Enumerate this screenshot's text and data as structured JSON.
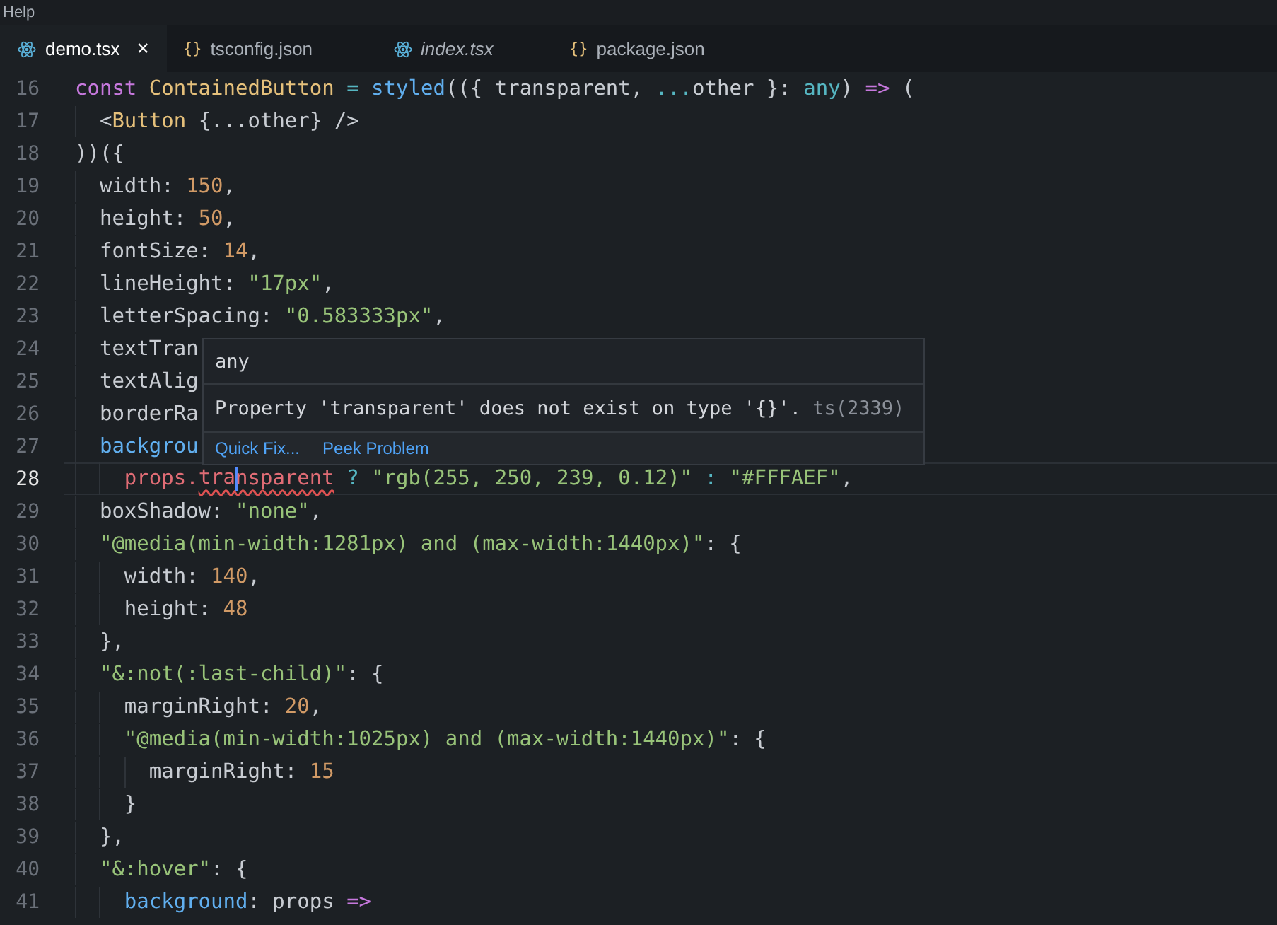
{
  "menu_bar": {
    "label": "Help"
  },
  "tabs": [
    {
      "label": "demo.tsx",
      "kind": "react",
      "selected": true,
      "preview": false,
      "close_glyph": "×"
    },
    {
      "label": "tsconfig.json",
      "kind": "json",
      "glyph": "{}",
      "selected": false,
      "preview": false
    },
    {
      "label": "index.tsx",
      "kind": "react",
      "selected": false,
      "preview": true
    },
    {
      "label": "package.json",
      "kind": "json",
      "glyph": "{}",
      "selected": false,
      "preview": false
    }
  ],
  "editor": {
    "lines": [
      {
        "number": "16",
        "current": false,
        "tokens": [
          {
            "kind": "kw",
            "text": "const "
          },
          {
            "kind": "type",
            "text": "ContainedButton"
          },
          {
            "kind": "op",
            "text": " = "
          },
          {
            "kind": "fn",
            "text": "styled"
          },
          {
            "kind": "plain",
            "text": "(({ transparent, "
          },
          {
            "kind": "op",
            "text": "..."
          },
          {
            "kind": "plain",
            "text": "other }: "
          },
          {
            "kind": "op",
            "text": "any"
          },
          {
            "kind": "plain",
            "text": ") "
          },
          {
            "kind": "kw",
            "text": "=>"
          },
          {
            "kind": "plain",
            "text": " ("
          }
        ]
      },
      {
        "number": "17",
        "current": false,
        "tokens": [
          {
            "kind": "plain",
            "text": "  <"
          },
          {
            "kind": "type",
            "text": "Button"
          },
          {
            "kind": "plain",
            "text": " {...other} />"
          }
        ]
      },
      {
        "number": "18",
        "current": false,
        "tokens": [
          {
            "kind": "plain",
            "text": "))({"
          }
        ]
      },
      {
        "number": "19",
        "current": false,
        "tokens": [
          {
            "kind": "plain",
            "text": "  width: "
          },
          {
            "kind": "num",
            "text": "150"
          },
          {
            "kind": "plain",
            "text": ","
          }
        ]
      },
      {
        "number": "20",
        "current": false,
        "tokens": [
          {
            "kind": "plain",
            "text": "  height: "
          },
          {
            "kind": "num",
            "text": "50"
          },
          {
            "kind": "plain",
            "text": ","
          }
        ]
      },
      {
        "number": "21",
        "current": false,
        "tokens": [
          {
            "kind": "plain",
            "text": "  fontSize: "
          },
          {
            "kind": "num",
            "text": "14"
          },
          {
            "kind": "plain",
            "text": ","
          }
        ]
      },
      {
        "number": "22",
        "current": false,
        "tokens": [
          {
            "kind": "plain",
            "text": "  lineHeight: "
          },
          {
            "kind": "str",
            "text": "\"17px\""
          },
          {
            "kind": "plain",
            "text": ","
          }
        ]
      },
      {
        "number": "23",
        "current": false,
        "tokens": [
          {
            "kind": "plain",
            "text": "  letterSpacing: "
          },
          {
            "kind": "str",
            "text": "\"0.583333px\""
          },
          {
            "kind": "plain",
            "text": ","
          }
        ]
      },
      {
        "number": "24",
        "current": false,
        "tokens": [
          {
            "kind": "plain",
            "text": "  textTran"
          }
        ]
      },
      {
        "number": "25",
        "current": false,
        "tokens": [
          {
            "kind": "plain",
            "text": "  textAlig"
          }
        ]
      },
      {
        "number": "26",
        "current": false,
        "tokens": [
          {
            "kind": "plain",
            "text": "  borderRa"
          }
        ]
      },
      {
        "number": "27",
        "current": false,
        "tokens": [
          {
            "kind": "prop",
            "text": "  backgrou"
          }
        ]
      },
      {
        "number": "28",
        "current": true,
        "tokens": [
          {
            "kind": "var",
            "text": "    props."
          },
          {
            "kind": "error",
            "text": "tra",
            "cursor_after": true
          },
          {
            "kind": "error",
            "text": "nsparent"
          },
          {
            "kind": "op",
            "text": " ? "
          },
          {
            "kind": "str",
            "text": "\"rgb(255, 250, 239, 0.12)\""
          },
          {
            "kind": "op",
            "text": " : "
          },
          {
            "kind": "str",
            "text": "\"#FFFAEF\""
          },
          {
            "kind": "plain",
            "text": ","
          }
        ]
      },
      {
        "number": "29",
        "current": false,
        "tokens": [
          {
            "kind": "plain",
            "text": "  boxShadow: "
          },
          {
            "kind": "str",
            "text": "\"none\""
          },
          {
            "kind": "plain",
            "text": ","
          }
        ]
      },
      {
        "number": "30",
        "current": false,
        "tokens": [
          {
            "kind": "str",
            "text": "  \"@media(min-width:1281px) and (max-width:1440px)\""
          },
          {
            "kind": "plain",
            "text": ": {"
          }
        ]
      },
      {
        "number": "31",
        "current": false,
        "tokens": [
          {
            "kind": "plain",
            "text": "    width: "
          },
          {
            "kind": "num",
            "text": "140"
          },
          {
            "kind": "plain",
            "text": ","
          }
        ]
      },
      {
        "number": "32",
        "current": false,
        "tokens": [
          {
            "kind": "plain",
            "text": "    height: "
          },
          {
            "kind": "num",
            "text": "48"
          }
        ]
      },
      {
        "number": "33",
        "current": false,
        "tokens": [
          {
            "kind": "plain",
            "text": "  },"
          }
        ]
      },
      {
        "number": "34",
        "current": false,
        "tokens": [
          {
            "kind": "str",
            "text": "  \"&:not(:last-child)\""
          },
          {
            "kind": "plain",
            "text": ": {"
          }
        ]
      },
      {
        "number": "35",
        "current": false,
        "tokens": [
          {
            "kind": "plain",
            "text": "    marginRight: "
          },
          {
            "kind": "num",
            "text": "20"
          },
          {
            "kind": "plain",
            "text": ","
          }
        ]
      },
      {
        "number": "36",
        "current": false,
        "tokens": [
          {
            "kind": "str",
            "text": "    \"@media(min-width:1025px) and (max-width:1440px)\""
          },
          {
            "kind": "plain",
            "text": ": {"
          }
        ]
      },
      {
        "number": "37",
        "current": false,
        "tokens": [
          {
            "kind": "plain",
            "text": "      marginRight: "
          },
          {
            "kind": "num",
            "text": "15"
          }
        ]
      },
      {
        "number": "38",
        "current": false,
        "tokens": [
          {
            "kind": "plain",
            "text": "    }"
          }
        ]
      },
      {
        "number": "39",
        "current": false,
        "tokens": [
          {
            "kind": "plain",
            "text": "  },"
          }
        ]
      },
      {
        "number": "40",
        "current": false,
        "tokens": [
          {
            "kind": "str",
            "text": "  \"&:hover\""
          },
          {
            "kind": "plain",
            "text": ": {"
          }
        ]
      },
      {
        "number": "41",
        "current": false,
        "tokens": [
          {
            "kind": "prop",
            "text": "    background"
          },
          {
            "kind": "plain",
            "text": ": props "
          },
          {
            "kind": "kw",
            "text": "=>"
          }
        ]
      }
    ]
  },
  "hover": {
    "type_text": "any",
    "message": "Property 'transparent' does not exist on type '{}'.",
    "code": "ts(2339)",
    "actions": [
      "Quick Fix...",
      "Peek Problem"
    ]
  }
}
